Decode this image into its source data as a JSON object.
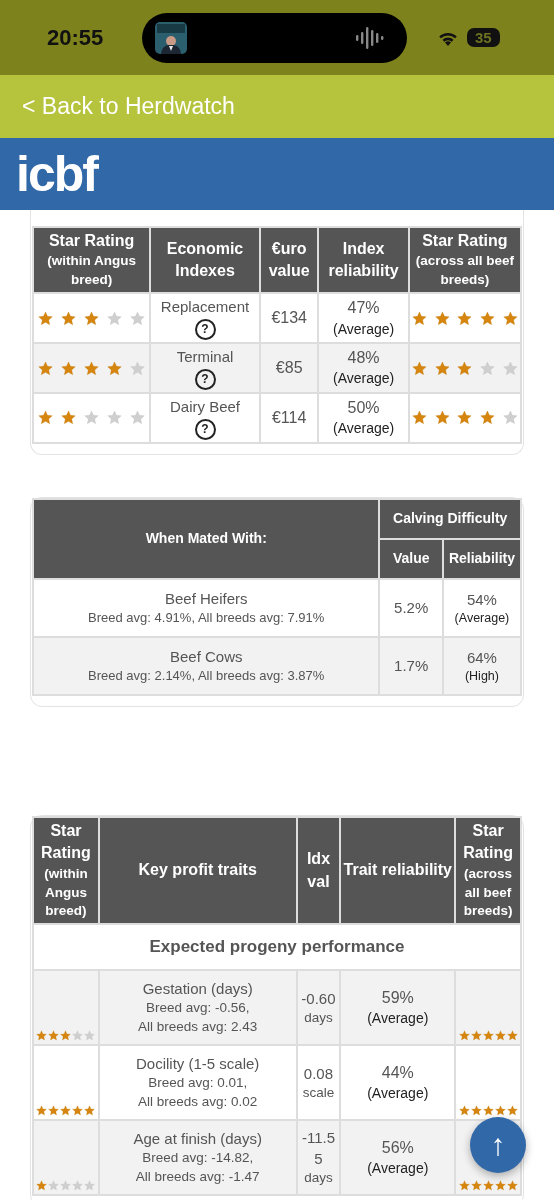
{
  "status_bar": {
    "time": "20:55",
    "battery": "35"
  },
  "back_link": {
    "label": "< Back to Herdwatch"
  },
  "logo": {
    "text": "icbf"
  },
  "economic_table": {
    "columns": [
      {
        "title": "Star Rating",
        "subtitle": "(within Angus breed)"
      },
      {
        "title": "Economic Indexes"
      },
      {
        "title": "€uro value"
      },
      {
        "title": "Index reliability"
      },
      {
        "title": "Star Rating",
        "subtitle": "(across all beef breeds)"
      }
    ],
    "rows": [
      {
        "within": {
          "stars": 3
        },
        "name": "Replacement",
        "help": "?",
        "value": "€134",
        "reliability": "47%",
        "reliability_label": "(Average)",
        "across": {
          "stars": 5
        }
      },
      {
        "within": {
          "stars": 4
        },
        "name": "Terminal",
        "help": "?",
        "value": "€85",
        "reliability": "48%",
        "reliability_label": "(Average)",
        "across": {
          "stars": 3
        }
      },
      {
        "within": {
          "stars": 2
        },
        "name": "Dairy Beef",
        "help": "?",
        "value": "€114",
        "reliability": "50%",
        "reliability_label": "(Average)",
        "across": {
          "stars": 4
        }
      }
    ]
  },
  "calving_table": {
    "first_column": "When Mated With:",
    "group": "Calving Difficulty",
    "columns": [
      "Value",
      "Reliability"
    ],
    "rows": [
      {
        "name": "Beef Heifers",
        "averages": "Breed avg: 4.91%, All breeds avg: 7.91%",
        "value": "5.2%",
        "reliability": "54%",
        "reliability_label": "(Average)"
      },
      {
        "name": "Beef Cows",
        "averages": "Breed avg: 2.14%, All breeds avg: 3.87%",
        "value": "1.7%",
        "reliability": "64%",
        "reliability_label": "(High)"
      }
    ]
  },
  "traits_table": {
    "columns": [
      {
        "title": "Star Rating",
        "subtitle": "(within Angus breed)"
      },
      {
        "title": "Key profit traits"
      },
      {
        "title": "Idx val"
      },
      {
        "title": "Trait reliability"
      },
      {
        "title": "Star Rating",
        "subtitle": "(across all beef breeds)"
      }
    ],
    "section": "Expected progeny performance",
    "rows": [
      {
        "within": {
          "stars": 3
        },
        "name": "Gestation (days)",
        "breed_avg": "Breed avg: -0.56,",
        "all_breeds_avg": "All breeds avg: 2.43",
        "value": "-0.60",
        "unit": "days",
        "reliability": "59%",
        "reliability_label": "(Average)",
        "across": {
          "stars": 5
        }
      },
      {
        "within": {
          "stars": 5
        },
        "name": "Docility (1-5 scale)",
        "breed_avg": "Breed avg: 0.01,",
        "all_breeds_avg": "All breeds avg: 0.02",
        "value": "0.08",
        "unit": "scale",
        "reliability": "44%",
        "reliability_label": "(Average)",
        "across": {
          "stars": 5
        }
      },
      {
        "within": {
          "stars": 1
        },
        "name": "Age at finish (days)",
        "breed_avg": "Breed avg: -14.82,",
        "all_breeds_avg": "All breeds avg: -1.47",
        "value": "-11.55",
        "unit": "days",
        "reliability": "56%",
        "reliability_label": "(Average)",
        "across": {
          "stars": 5
        }
      }
    ]
  },
  "scroll_top_button": {
    "label": "↑"
  }
}
